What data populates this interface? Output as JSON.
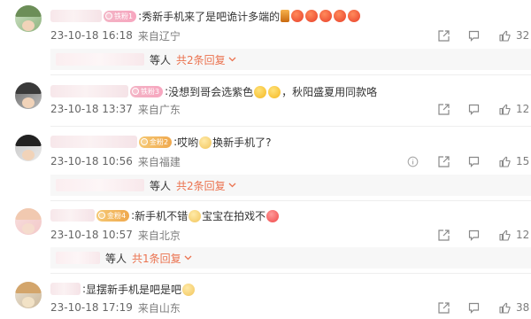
{
  "comments": [
    {
      "badge": "铁粉1",
      "badge_style": "pink",
      "text": "秀新手机来了是吧诡计多端的",
      "emojis_after": [
        "candle",
        "red",
        "red",
        "red",
        "red",
        "red"
      ],
      "date": "23-10-18 16:18",
      "location": "来自辽宁",
      "likes": "32",
      "reply": {
        "who": "等人",
        "link": "共2条回复"
      }
    },
    {
      "badge": "铁粉3",
      "badge_style": "pink",
      "text_before": "没想到哥会选紫色",
      "text_after": "，秋阳盛夏用同款咯",
      "date": "23-10-18 13:37",
      "location": "来自广东",
      "likes": "12"
    },
    {
      "badge": "金粉2",
      "badge_style": "gold",
      "text_before": "哎哟",
      "text_after": "换新手机了?",
      "date": "23-10-18 10:56",
      "location": "来自福建",
      "likes": "15",
      "reply": {
        "who": "等人",
        "link": "共2条回复"
      }
    },
    {
      "badge": "金粉4",
      "badge_style": "gold",
      "text_before": "新手机不错",
      "text_after": "宝宝在拍戏不",
      "date": "23-10-18 10:57",
      "location": "来自北京",
      "likes": "12",
      "reply": {
        "who": "等人",
        "link": "共1条回复"
      }
    },
    {
      "text": "显摆新手机是吧是吧",
      "date": "23-10-18 17:19",
      "location": "来自山东",
      "likes": "38"
    }
  ],
  "icons": {
    "share": "share-icon",
    "comment": "comment-icon",
    "like": "thumbs-up-icon",
    "caret": "chevron-down-icon"
  },
  "colors": {
    "link": "#eb7350",
    "meta": "#7d7d7d"
  }
}
